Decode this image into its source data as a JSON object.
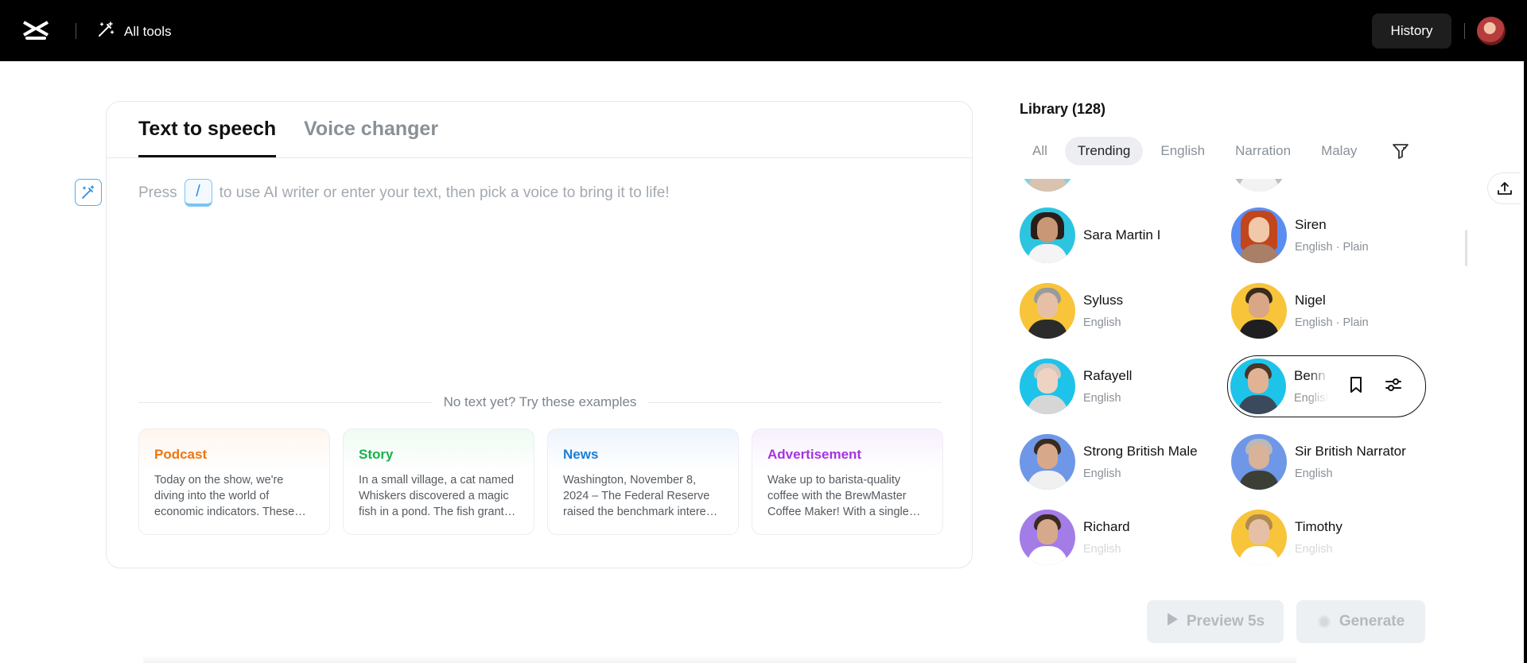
{
  "header": {
    "all_tools_label": "All tools",
    "history_label": "History"
  },
  "editor": {
    "tabs": [
      {
        "label": "Text to speech",
        "active": true
      },
      {
        "label": "Voice changer",
        "active": false
      }
    ],
    "placeholder_before": "Press",
    "placeholder_key": "/",
    "placeholder_after": "to use AI writer or enter your text, then pick a voice to bring it to life!",
    "examples_heading": "No text yet? Try these examples",
    "examples": [
      {
        "title": "Podcast",
        "text": "Today on the show, we're diving into the world of economic indicators. These numbers shape our understanding of the economy."
      },
      {
        "title": "Story",
        "text": "In a small village, a cat named Whiskers discovered a magic fish in a pond. The fish granted wishes."
      },
      {
        "title": "News",
        "text": "Washington, November 8, 2024 – The Federal Reserve raised the benchmark interest rate."
      },
      {
        "title": "Advertisement",
        "text": "Wake up to barista-quality coffee with the BrewMaster Coffee Maker! With a single touch."
      }
    ]
  },
  "library": {
    "title": "Library (128)",
    "filters": [
      "All",
      "Trending",
      "English",
      "Narration",
      "Malay"
    ],
    "active_filter": "Trending",
    "voices": [
      {
        "name": "Sara Martin I",
        "meta": ""
      },
      {
        "name": "Siren",
        "meta": "English · Plain"
      },
      {
        "name": "Syluss",
        "meta": "English"
      },
      {
        "name": "Nigel",
        "meta": "English · Plain"
      },
      {
        "name": "Rafayell",
        "meta": "English"
      },
      {
        "name": "Benn",
        "meta": "English"
      },
      {
        "name": "Strong British Male",
        "meta": "English"
      },
      {
        "name": "Sir British Narrator",
        "meta": "English"
      },
      {
        "name": "Richard",
        "meta": "English"
      },
      {
        "name": "Timothy",
        "meta": "English"
      }
    ],
    "selected_voice": "Benn"
  },
  "actions": {
    "preview_label": "Preview 5s",
    "generate_label": "Generate"
  },
  "colors": {
    "podcast": "#f0750f",
    "story": "#16b24b",
    "news": "#1a7fd8",
    "advertisement": "#a433e0",
    "accent": "#2b8de0"
  }
}
